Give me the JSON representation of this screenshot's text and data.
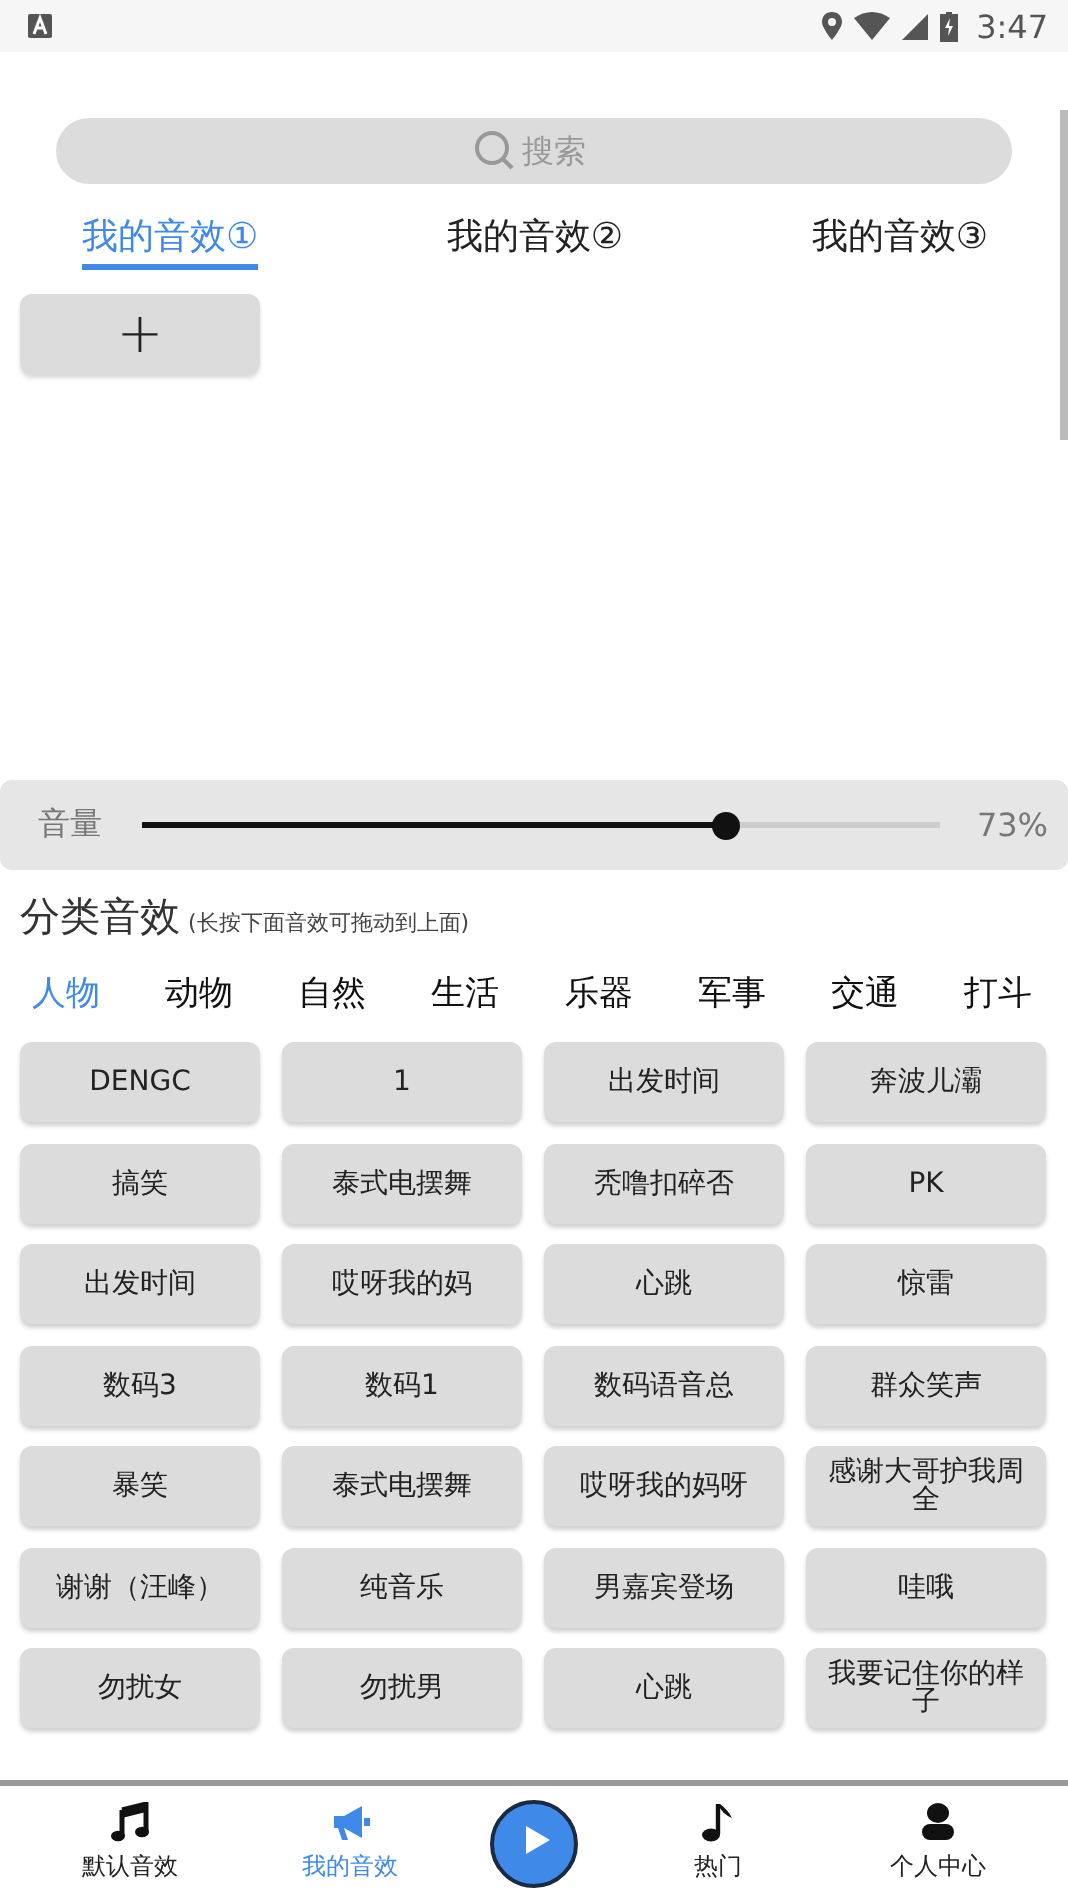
{
  "status_bar": {
    "time": "3:47"
  },
  "search": {
    "placeholder": "搜索"
  },
  "tabs": [
    {
      "label": "我的音效①",
      "selected": true
    },
    {
      "label": "我的音效②",
      "selected": false
    },
    {
      "label": "我的音效③",
      "selected": false
    }
  ],
  "add_button": {
    "label": "+"
  },
  "volume": {
    "label": "音量",
    "level": 0.73,
    "reading": "73%"
  },
  "category_section": {
    "title": "分类音效",
    "hint": "(长按下面音效可拖动到上面)"
  },
  "categories": [
    {
      "label": "人物",
      "selected": true
    },
    {
      "label": "动物",
      "selected": false
    },
    {
      "label": "自然",
      "selected": false
    },
    {
      "label": "生活",
      "selected": false
    },
    {
      "label": "乐器",
      "selected": false
    },
    {
      "label": "军事",
      "selected": false
    },
    {
      "label": "交通",
      "selected": false
    },
    {
      "label": "打斗",
      "selected": false
    }
  ],
  "sounds": [
    "DENGC",
    "1",
    "出发时间",
    "奔波儿灞",
    "搞笑",
    "泰式电摆舞",
    "秃噜扣碎否",
    "PK",
    "出发时间",
    "哎呀我的妈",
    "心跳",
    "惊雷",
    "数码3",
    "数码1",
    "数码语音总",
    "群众笑声",
    "暴笑",
    "泰式电摆舞",
    "哎呀我的妈呀",
    "感谢大哥护我周全",
    "谢谢（汪峰）",
    "纯音乐",
    "男嘉宾登场",
    "哇哦",
    "勿扰女",
    "勿扰男",
    "心跳",
    "我要记住你的样子"
  ],
  "nav": [
    {
      "label": "默认音效",
      "kind": "notes",
      "selected": false
    },
    {
      "label": "我的音效",
      "kind": "megaphone",
      "selected": true
    },
    {
      "kind": "play"
    },
    {
      "label": "热门",
      "kind": "note",
      "selected": false
    },
    {
      "label": "个人中心",
      "kind": "person",
      "selected": false
    }
  ]
}
